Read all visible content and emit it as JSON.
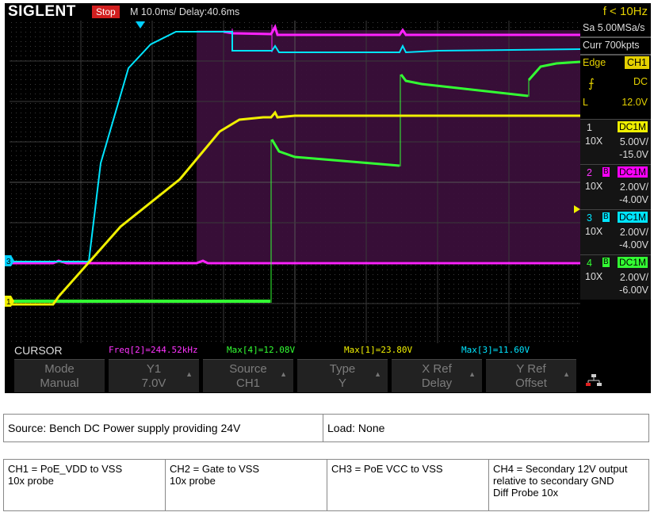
{
  "scope": {
    "brand": "SIGLENT",
    "run_state": "Stop",
    "timebase": "M 10.0ms/ Delay:40.6ms",
    "trigger_freq": "f < 10Hz",
    "sample_rate": "Sa 5.00MSa/s",
    "memory_depth": "Curr 700kpts",
    "trigger": {
      "type": "Edge",
      "source": "CH1",
      "slope_icon": "rising-edge-icon",
      "coupling": "DC",
      "level_label": "L",
      "level": "12.0V"
    },
    "channels": [
      {
        "num": "1",
        "probe": "10X",
        "coupling": "DC1M",
        "bw": "",
        "scale": "5.00V/",
        "offset": "-15.0V",
        "color": "#f0f000"
      },
      {
        "num": "2",
        "probe": "10X",
        "coupling": "DC1M",
        "bw": "B",
        "scale": "2.00V/",
        "offset": "-4.00V",
        "color": "#ff00ff"
      },
      {
        "num": "3",
        "probe": "10X",
        "coupling": "DC1M",
        "bw": "B",
        "scale": "2.00V/",
        "offset": "-4.00V",
        "color": "#00e5ff"
      },
      {
        "num": "4",
        "probe": "10X",
        "coupling": "DC1M",
        "bw": "B",
        "scale": "2.00V/",
        "offset": "-6.00V",
        "color": "#33ff33"
      }
    ],
    "channel_markers": {
      "ch3": "3",
      "ch1": "1"
    },
    "cursor": {
      "label": "CURSOR",
      "measurements": [
        {
          "text": "Freq[2]=244.52kHz",
          "color": "#ff33ff"
        },
        {
          "text": "Max[4]=12.08V",
          "color": "#33ff33"
        },
        {
          "text": "Max[1]=23.80V",
          "color": "#f0f000"
        },
        {
          "text": "Max[3]=11.60V",
          "color": "#00e5ff"
        }
      ]
    },
    "softkeys": [
      {
        "line1": "Mode",
        "line2": "Manual",
        "arrow": false
      },
      {
        "line1": "Y1",
        "line2": "7.0V",
        "arrow": true
      },
      {
        "line1": "Source",
        "line2": "CH1",
        "arrow": true
      },
      {
        "line1": "Type",
        "line2": "Y",
        "arrow": true
      },
      {
        "line1": "X Ref",
        "line2": "Delay",
        "arrow": true
      },
      {
        "line1": "Y Ref",
        "line2": "Offset",
        "arrow": true
      }
    ],
    "network_icon": "network-icon"
  },
  "notes": {
    "source": "Source: Bench DC Power supply providing 24V",
    "load": "Load: None",
    "ch1": [
      "CH1 = PoE_VDD to VSS",
      "10x probe"
    ],
    "ch2": [
      "CH2 = Gate to VSS",
      "10x probe"
    ],
    "ch3": [
      "CH3 = PoE VCC to VSS"
    ],
    "ch4": [
      "CH4 = Secondary 12V output",
      "relative to secondary GND",
      "Diff Probe 10x"
    ]
  }
}
